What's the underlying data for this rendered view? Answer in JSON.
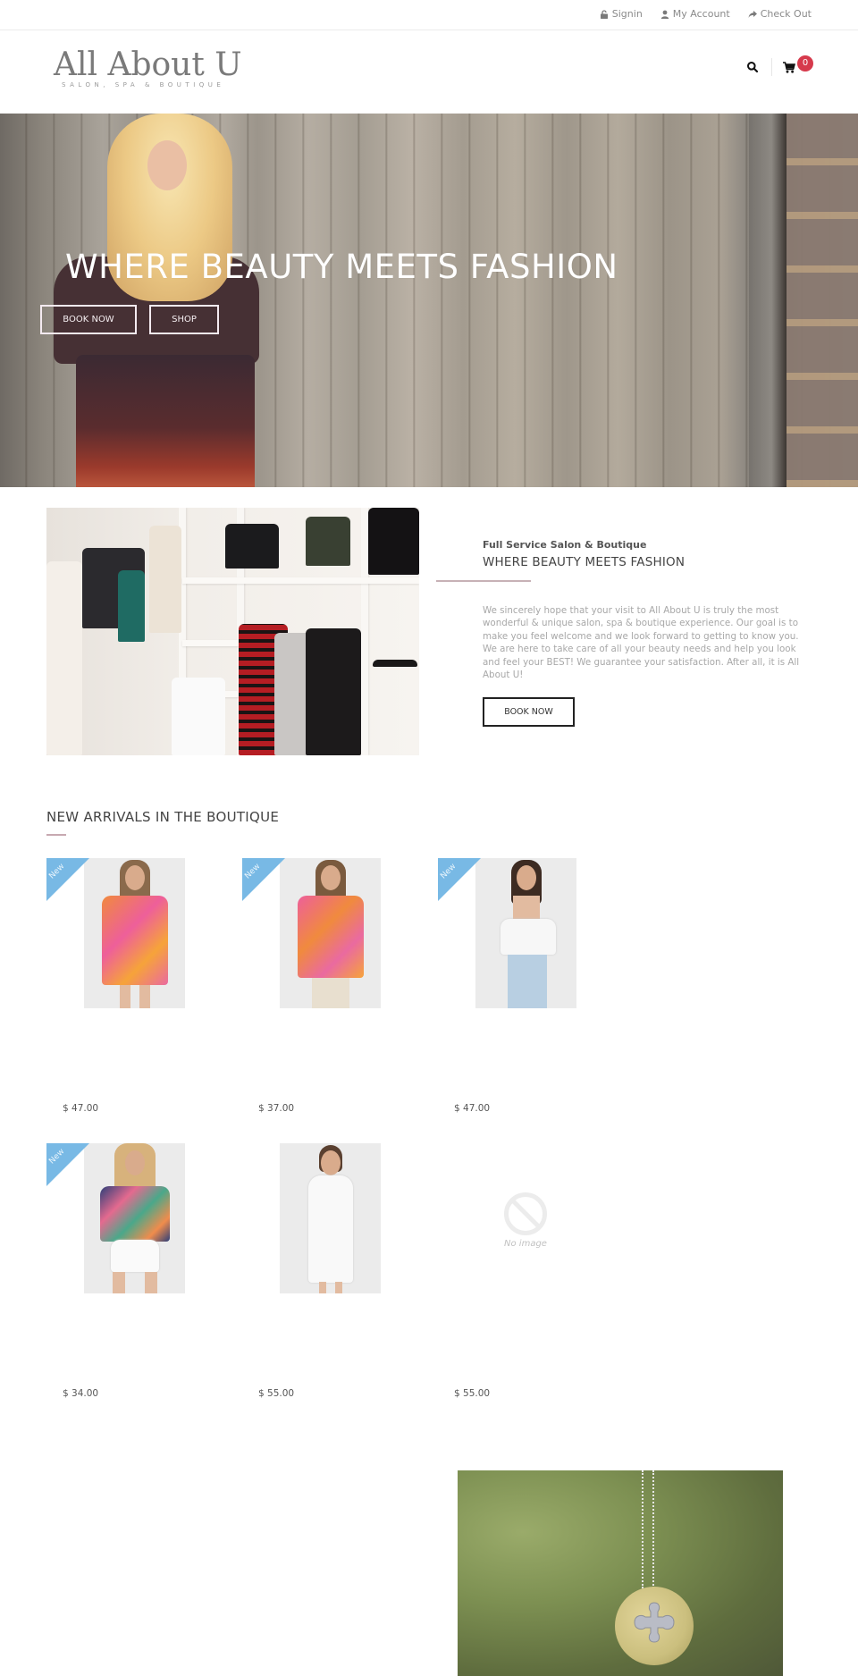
{
  "topbar": {
    "links": [
      {
        "label": "Signin",
        "icon": "lock-icon"
      },
      {
        "label": "My Account",
        "icon": "user-icon"
      },
      {
        "label": "Check Out",
        "icon": "share-arrow-icon"
      }
    ]
  },
  "header": {
    "logo_name": "All About U",
    "logo_tagline": "SALON, SPA & BOUTIQUE",
    "cart_count": "0",
    "search_icon": "search-icon",
    "cart_icon": "cart-icon"
  },
  "hero": {
    "title": "WHERE BEAUTY MEETS FASHION",
    "book_label": "BOOK NOW",
    "shop_label": "SHOP"
  },
  "about": {
    "kicker": "Full Service Salon & Boutique",
    "title": "WHERE BEAUTY MEETS FASHION",
    "body": "We sincerely hope that your visit to All About U is truly the most wonderful & unique salon, spa & boutique experience. Our goal is to make you feel welcome and we look forward to getting to know you. We are here to take care of all your beauty needs and help you look and feel your BEST! We guarantee your satisfaction. After all, it is All About U!",
    "book_label": "BOOK NOW"
  },
  "arrivals": {
    "title": "NEW ARRIVALS IN THE BOUTIQUE",
    "badge_label": "New",
    "no_image_label": "No image",
    "products": [
      {
        "price": "$ 47.00",
        "is_new": true,
        "has_image": true
      },
      {
        "price": "$ 37.00",
        "is_new": true,
        "has_image": true
      },
      {
        "price": "$ 47.00",
        "is_new": true,
        "has_image": true
      },
      {
        "price": "$ 34.00",
        "is_new": true,
        "has_image": true
      },
      {
        "price": "$ 55.00",
        "is_new": false,
        "has_image": true
      },
      {
        "price": "$ 55.00",
        "is_new": false,
        "has_image": false
      }
    ]
  },
  "colors": {
    "badge_blue": "#78b9e5",
    "cart_badge_red": "#d63a4c",
    "accent_rule": "#c7b1b6"
  }
}
